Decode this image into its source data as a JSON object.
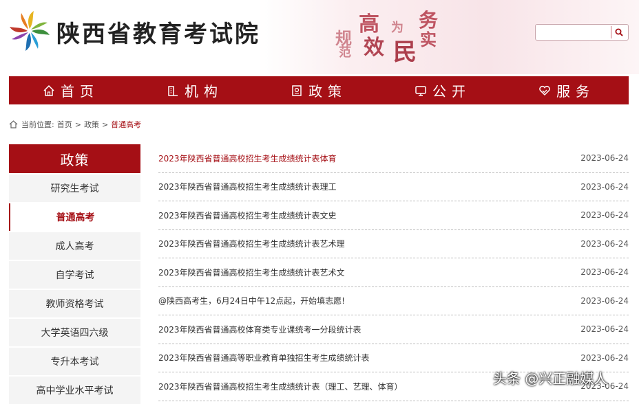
{
  "header": {
    "site_title": "陕西省教育考试院",
    "slogans": [
      "规",
      "范",
      "高",
      "效",
      "为",
      "民",
      "务",
      "实"
    ],
    "search": {
      "placeholder": "",
      "value": ""
    },
    "icons": {
      "logo": "pinwheel-logo",
      "search": "search-icon"
    }
  },
  "nav": {
    "items": [
      {
        "label": "首页",
        "icon": "home-icon"
      },
      {
        "label": "机构",
        "icon": "building-icon"
      },
      {
        "label": "政策",
        "icon": "document-icon"
      },
      {
        "label": "公开",
        "icon": "monitor-icon"
      },
      {
        "label": "服务",
        "icon": "heart-hand-icon"
      }
    ]
  },
  "breadcrumb": {
    "prefix": "当前位置:",
    "items": [
      "首页",
      "政策",
      "普通高考"
    ],
    "separator": ">"
  },
  "sidebar": {
    "title": "政策",
    "items": [
      {
        "label": "研究生考试",
        "active": false
      },
      {
        "label": "普通高考",
        "active": true
      },
      {
        "label": "成人高考",
        "active": false
      },
      {
        "label": "自学考试",
        "active": false
      },
      {
        "label": "教师资格考试",
        "active": false
      },
      {
        "label": "大学英语四六级",
        "active": false
      },
      {
        "label": "专升本考试",
        "active": false
      },
      {
        "label": "高中学业水平考试",
        "active": false
      }
    ]
  },
  "articles": [
    {
      "title": "2023年陕西省普通高校招生考生成绩统计表体育",
      "date": "2023-06-24"
    },
    {
      "title": "2023年陕西省普通高校招生考生成绩统计表理工",
      "date": "2023-06-24"
    },
    {
      "title": "2023年陕西省普通高校招生考生成绩统计表文史",
      "date": "2023-06-24"
    },
    {
      "title": "2023年陕西省普通高校招生考生成绩统计表艺术理",
      "date": "2023-06-24"
    },
    {
      "title": "2023年陕西省普通高校招生考生成绩统计表艺术文",
      "date": "2023-06-24"
    },
    {
      "title": "@陕西高考生，6月24日中午12点起，开始填志愿!",
      "date": "2023-06-24"
    },
    {
      "title": "2023年陕西省普通高校体育类专业课统考一分段统计表",
      "date": "2023-06-24"
    },
    {
      "title": "2023年陕西省普通高等职业教育单独招生考生成绩统计表",
      "date": "2023-06-24"
    },
    {
      "title": "2023年陕西省普通高校招生考生成绩统计表（理工、艺理、体育）",
      "date": "2023-06-24"
    }
  ],
  "watermark": "头条 @兴正融媒人",
  "colors": {
    "brand": "#a50f15",
    "sidebar_bg": "#f4f4f4",
    "text": "#333333"
  }
}
